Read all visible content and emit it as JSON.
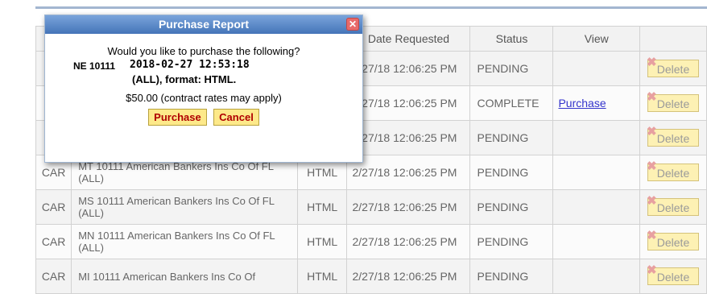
{
  "table": {
    "headers": [
      "",
      "",
      "",
      "Date Requested",
      "Status",
      "View",
      ""
    ],
    "rows": [
      {
        "type": "",
        "description": "",
        "format": "",
        "date": "2/27/18 12:06:25 PM",
        "status": "PENDING",
        "view": "",
        "action": "Delete"
      },
      {
        "type": "",
        "description": "",
        "format": "",
        "date": "2/27/18 12:06:25 PM",
        "status": "COMPLETE",
        "view": "Purchase",
        "action": "Delete"
      },
      {
        "type": "",
        "description": "",
        "format": "",
        "date": "2/27/18 12:06:25 PM",
        "status": "PENDING",
        "view": "",
        "action": "Delete"
      },
      {
        "type": "CAR",
        "description": "MT 10111 American Bankers Ins Co Of FL (ALL)",
        "format": "HTML",
        "date": "2/27/18 12:06:25 PM",
        "status": "PENDING",
        "view": "",
        "action": "Delete"
      },
      {
        "type": "CAR",
        "description": "MS 10111 American Bankers Ins Co Of FL (ALL)",
        "format": "HTML",
        "date": "2/27/18 12:06:25 PM",
        "status": "PENDING",
        "view": "",
        "action": "Delete"
      },
      {
        "type": "CAR",
        "description": "MN 10111 American Bankers Ins Co Of FL (ALL)",
        "format": "HTML",
        "date": "2/27/18 12:06:25 PM",
        "status": "PENDING",
        "view": "",
        "action": "Delete"
      },
      {
        "type": "CAR",
        "description": "MI 10111 American Bankers Ins Co Of",
        "format": "HTML",
        "date": "2/27/18 12:06:25 PM",
        "status": "PENDING",
        "view": "",
        "action": "Delete"
      }
    ]
  },
  "dialog": {
    "title": "Purchase Report",
    "question": "Would you like to purchase the following?",
    "report_id": "NE 10111",
    "timestamp": "2018-02-27 12:53:18",
    "format_line": "(ALL), format: HTML.",
    "price_line": "$50.00 (contract rates may apply)",
    "purchase_label": "Purchase",
    "cancel_label": "Cancel",
    "close_icon": "close-icon"
  },
  "colors": {
    "title_bar": "#4a7bc0",
    "link": "#3333cc",
    "button_fill": "#fde98a",
    "button_text": "#b00000",
    "delete_fill": "#fdf1b4"
  }
}
